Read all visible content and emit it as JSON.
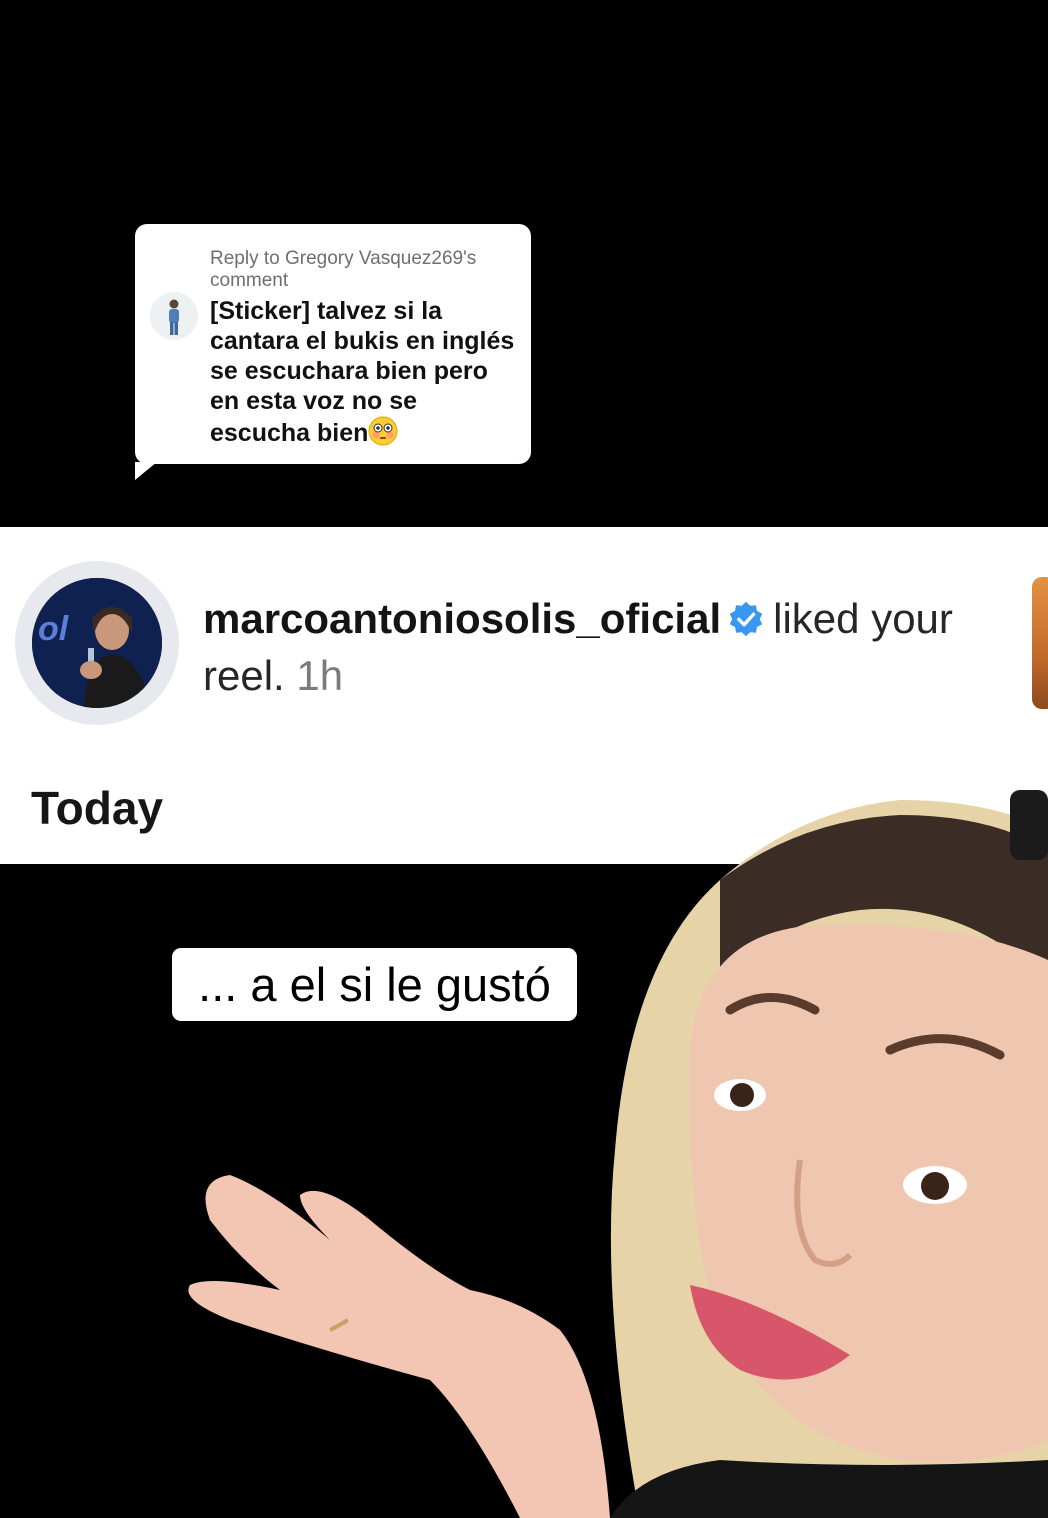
{
  "reply_card": {
    "header": "Reply to Gregory Vasquez269's comment",
    "comment": "[Sticker] talvez si la cantara el bukis en inglés se escuchara bien pero en esta voz no se escucha bien",
    "emoji": "😳",
    "avatar_icon": "user-avatar-icon"
  },
  "notification": {
    "username": "marcoantoniosolis_oficial",
    "verified_icon": "verified-badge-icon",
    "action": "liked your reel.",
    "time": "1h",
    "section_label": "Today"
  },
  "caption": {
    "text": "... a el si le gustó"
  },
  "colors": {
    "background": "#000000",
    "card": "#ffffff",
    "verified_blue": "#3897f0",
    "secondary_text": "#7b7b7b"
  }
}
